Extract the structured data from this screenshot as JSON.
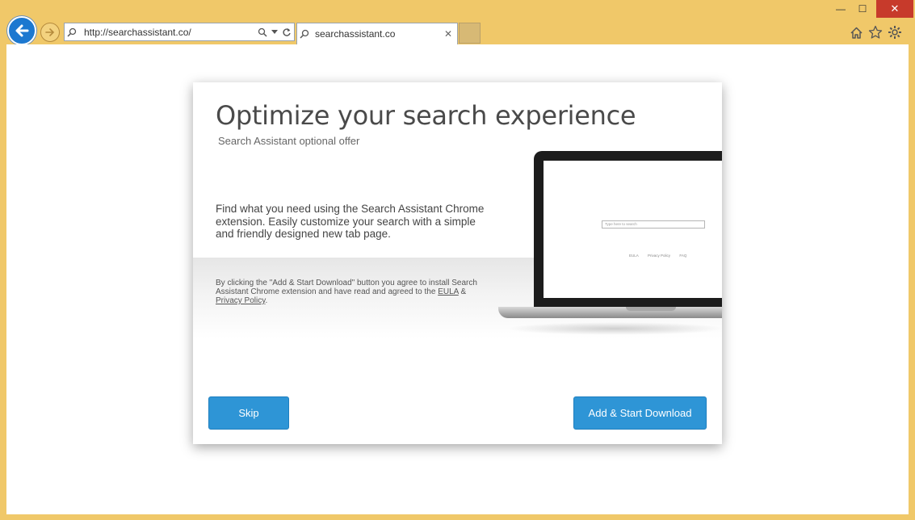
{
  "window": {
    "minimize_glyph": "—",
    "maximize_glyph": "☐",
    "close_glyph": "✕"
  },
  "browser": {
    "address_url": "http://searchassistant.co/",
    "tab_title": "searchassistant.co",
    "icons": [
      "back-icon",
      "forward-icon",
      "search-icon",
      "dropdown-icon",
      "refresh-icon",
      "close-icon",
      "home-icon",
      "favorites-star-icon",
      "settings-gear-icon"
    ]
  },
  "dialog": {
    "headline": "Optimize your search experience",
    "subtitle": "Search Assistant optional offer",
    "description": "Find what you need using the Search Assistant Chrome extension. Easily customize your search with a simple and friendly designed new tab page.",
    "legal_prefix": "By clicking the \"Add & Start Download\" button you agree to install Search Assistant Chrome extension and have read and agreed to the ",
    "eula_link": "EULA",
    "legal_and": " & ",
    "privacy_link": "Privacy Policy",
    "legal_suffix": ".",
    "skip_label": "Skip",
    "add_label": "Add & Start Download"
  },
  "laptop_screen": {
    "search_placeholder": "Type here to search",
    "links": [
      "EULA",
      "Privacy Policy",
      "FAQ"
    ]
  },
  "colors": {
    "frame": "#f0c869",
    "button_blue": "#2e95d6",
    "back_button": "#1c78d0",
    "close_red": "#c73a2b"
  }
}
